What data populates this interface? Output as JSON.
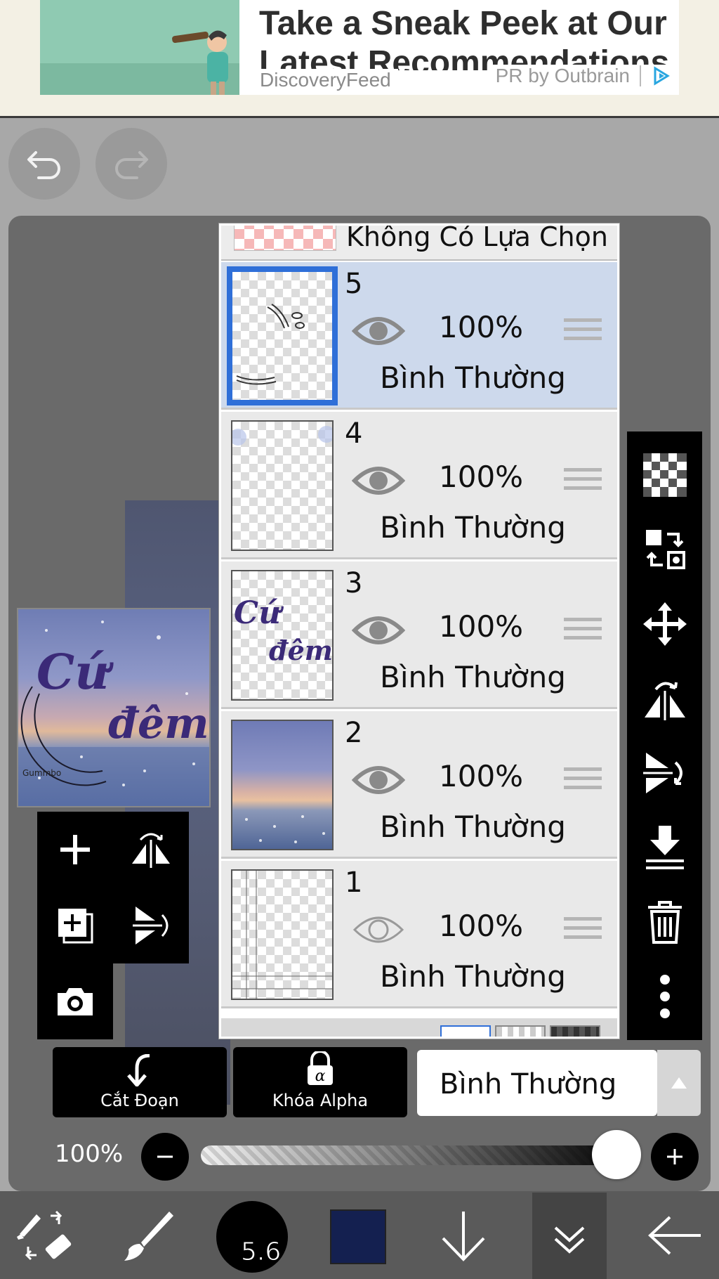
{
  "ad": {
    "headline": "Take a Sneak Peek at Our Latest Recommendations",
    "source": "DiscoveryFeed",
    "pr_label": "PR by Outbrain",
    "adchoices_icon": "adchoices-icon"
  },
  "history": {
    "undo_icon": "undo-icon",
    "redo_icon": "redo-icon"
  },
  "layers_panel": {
    "no_selection_label": "Không Có Lựa Chọn",
    "layers": [
      {
        "number": "5",
        "opacity": "100%",
        "blend_mode": "Bình Thường",
        "visible": true,
        "selected": true
      },
      {
        "number": "4",
        "opacity": "100%",
        "blend_mode": "Bình Thường",
        "visible": true,
        "selected": false
      },
      {
        "number": "3",
        "opacity": "100%",
        "blend_mode": "Bình Thường",
        "visible": true,
        "selected": false
      },
      {
        "number": "2",
        "opacity": "100%",
        "blend_mode": "Bình Thường",
        "visible": true,
        "selected": false
      },
      {
        "number": "1",
        "opacity": "100%",
        "blend_mode": "Bình Thường",
        "visible": false,
        "selected": false
      }
    ]
  },
  "preview": {
    "title_line1": "Cứ",
    "title_line2": "đêm",
    "signature": "Gummbo"
  },
  "mini_tools": [
    "add-layer-icon",
    "flip-horizontal-icon",
    "duplicate-layer-icon",
    "flip-vertical-icon",
    "camera-icon"
  ],
  "right_tools": [
    "transparency-icon",
    "layer-transfer-icon",
    "move-icon",
    "flip-horizontal-icon",
    "flip-vertical-icon",
    "merge-down-icon",
    "trash-icon",
    "more-icon"
  ],
  "actions": {
    "clipping_label": "Cắt Đoạn",
    "alpha_lock_label": "Khóa Alpha",
    "blend_mode_value": "Bình Thường"
  },
  "opacity": {
    "value_label": "100%",
    "level": 1.0
  },
  "bottom_toolbar": {
    "brush_size": "5.6",
    "current_color": "#142050",
    "icons": [
      "brush-eraser-toggle-icon",
      "brush-icon",
      "brush-size-icon",
      "color-swatch",
      "download-arrow-icon",
      "layers-tab-icon",
      "back-arrow-icon"
    ]
  },
  "colors": {
    "selected_layer_bg": "#cdd9ec",
    "selection_border": "#2f6fd8",
    "toolbar_bg": "#000000"
  }
}
